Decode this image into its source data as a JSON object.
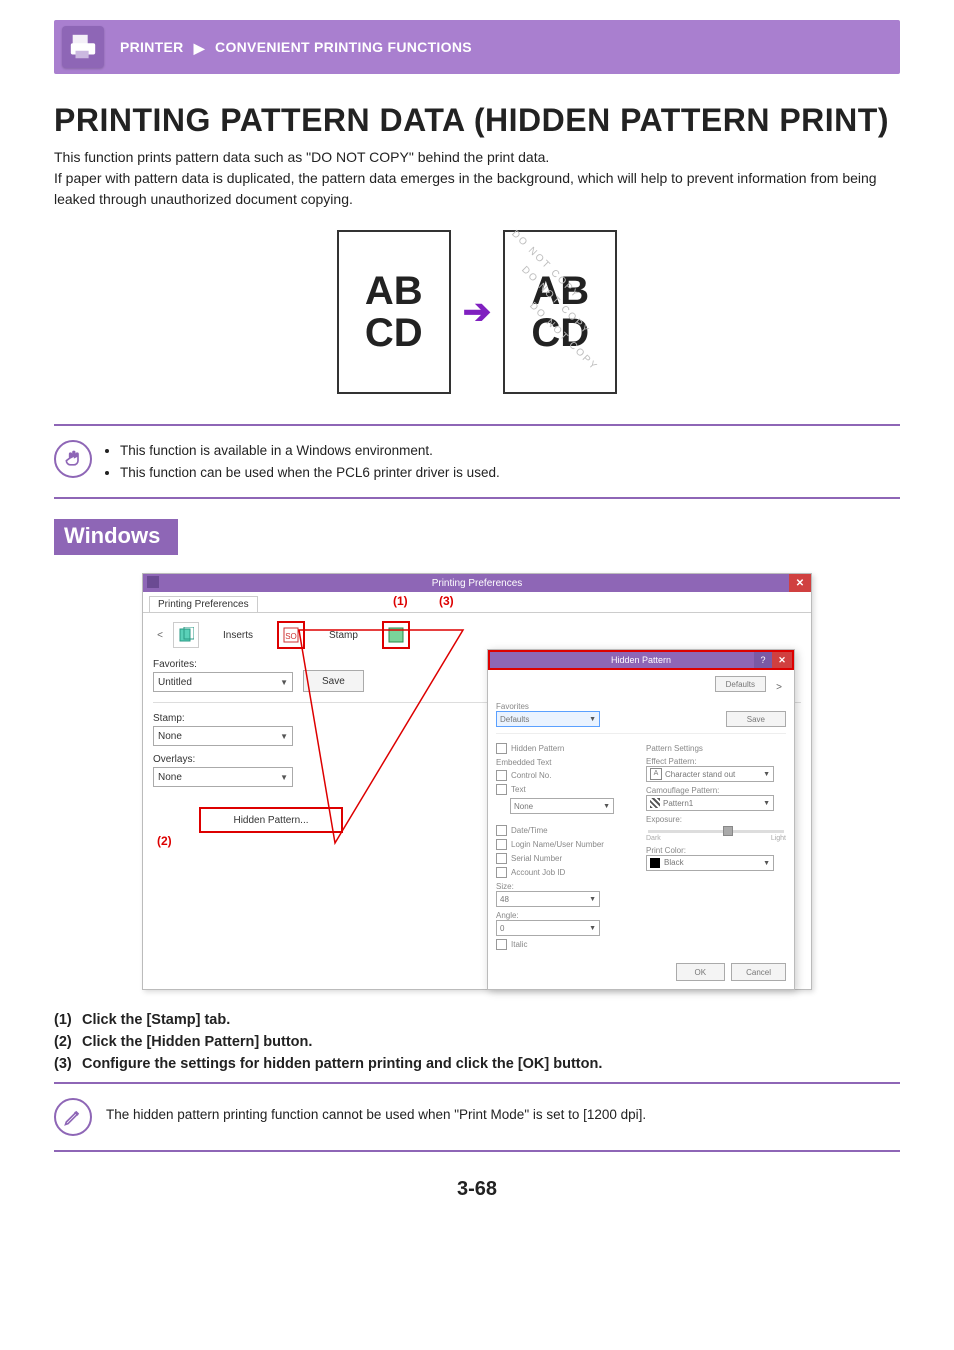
{
  "header": {
    "section": "PRINTER",
    "subsection": "CONVENIENT PRINTING FUNCTIONS"
  },
  "title": "PRINTING PATTERN DATA (HIDDEN PATTERN PRINT)",
  "intro": "This function prints pattern data such as \"DO NOT COPY\" behind the print data.\nIf paper with pattern data is duplicated, the pattern data emerges in the background, which will help to prevent information from being leaked through unauthorized document copying.",
  "illustration": {
    "sheet_line1": "AB",
    "sheet_line2": "CD",
    "watermark_text": "DO NOT COPY"
  },
  "notes_top": [
    "This function is available in a Windows environment.",
    "This function can be used when the PCL6 printer driver is used."
  ],
  "os_header": "Windows",
  "screenshot": {
    "window_title": "Printing Preferences",
    "tab_label": "Printing Preferences",
    "nav_prev": "<",
    "nav_next": ">",
    "tabs": {
      "inserts_label": "Inserts",
      "stamp_label": "Stamp"
    },
    "left_panel": {
      "favorites_label": "Favorites:",
      "favorites_value": "Untitled",
      "save_label": "Save",
      "stamp_label": "Stamp:",
      "stamp_value": "None",
      "overlays_label": "Overlays:",
      "overlays_value": "None",
      "hidden_pattern_button": "Hidden Pattern..."
    },
    "annotations": {
      "a1": "(1)",
      "a2": "(2)",
      "a3": "(3)"
    },
    "dialog": {
      "title": "Hidden Pattern",
      "defaults_button": "Defaults",
      "favorites_label": "Favorites",
      "favorites_value": "Defaults",
      "save_label": "Save",
      "hidden_pattern_chk": "Hidden Pattern",
      "embedded_text_label": "Embedded Text",
      "control_no_chk": "Control No.",
      "text_chk": "Text",
      "text_value": "None",
      "date_time_chk": "Date/Time",
      "login_chk": "Login Name/User Number",
      "serial_chk": "Serial Number",
      "account_chk": "Account Job ID",
      "size_label": "Size:",
      "size_value": "48",
      "angle_label": "Angle:",
      "angle_value": "0",
      "italic_chk": "Italic",
      "pattern_settings_label": "Pattern Settings",
      "effect_pattern_label": "Effect Pattern:",
      "effect_pattern_value": "Character stand out",
      "camouflage_label": "Camouflage Pattern:",
      "camouflage_value": "Pattern1",
      "exposure_label": "Exposure:",
      "exposure_dark": "Dark",
      "exposure_light": "Light",
      "print_color_label": "Print Color:",
      "print_color_value": "Black",
      "ok": "OK",
      "cancel": "Cancel"
    }
  },
  "steps": [
    {
      "num": "(1)",
      "text": "Click the [Stamp] tab."
    },
    {
      "num": "(2)",
      "text": "Click the [Hidden Pattern] button."
    },
    {
      "num": "(3)",
      "text": "Configure the settings for hidden pattern printing and click the [OK] button."
    }
  ],
  "note_bottom": "The hidden pattern printing function cannot be used when \"Print Mode\" is set to [1200 dpi].",
  "page_number": "3-68"
}
